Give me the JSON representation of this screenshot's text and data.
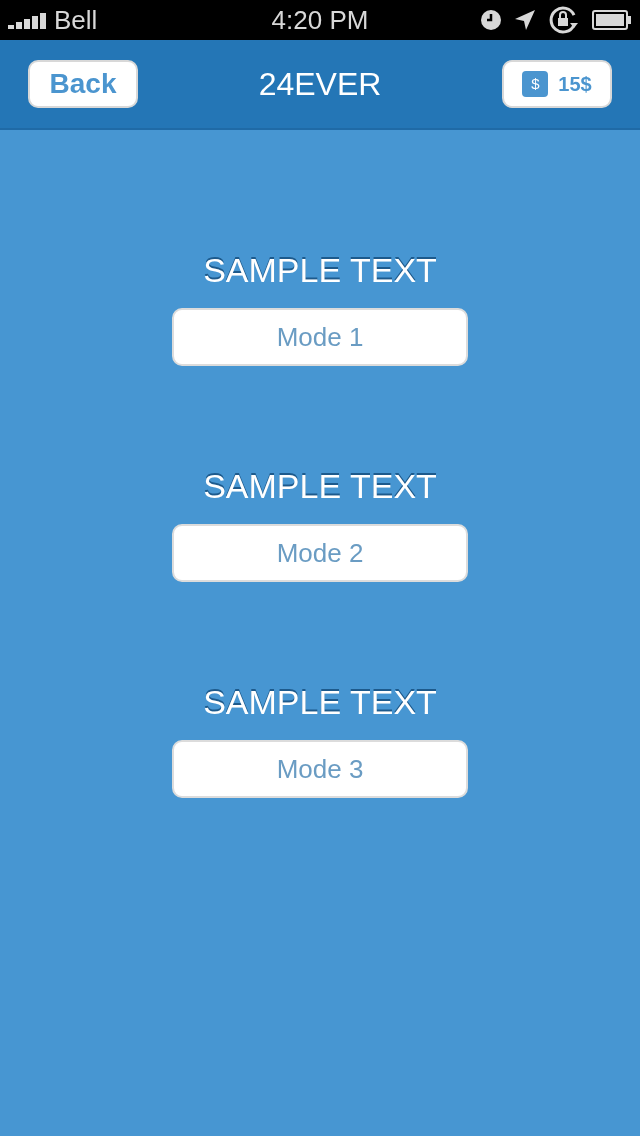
{
  "status_bar": {
    "carrier": "Bell",
    "time": "4:20 PM"
  },
  "nav_bar": {
    "back": "Back",
    "title": "24EVER",
    "coin_symbol": "$",
    "balance": "15$"
  },
  "sections": [
    {
      "heading": "SAMPLE TEXT",
      "button": "Mode 1"
    },
    {
      "heading": "SAMPLE TEXT",
      "button": "Mode 2"
    },
    {
      "heading": "SAMPLE TEXT",
      "button": "Mode 3"
    }
  ]
}
